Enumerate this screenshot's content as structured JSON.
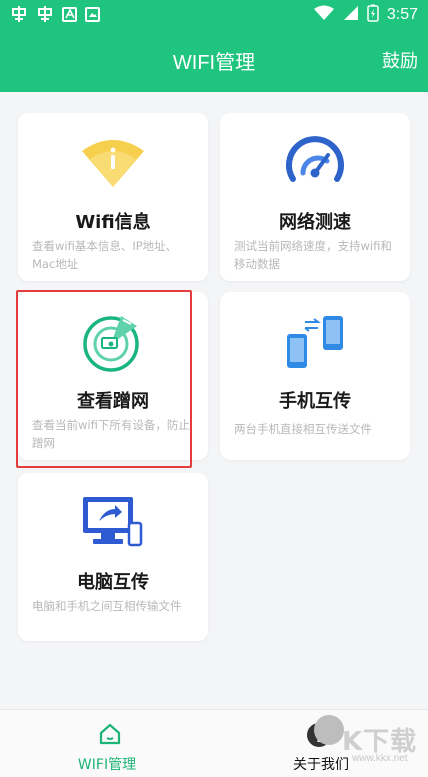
{
  "status_bar": {
    "left_icons": [
      "app-icon",
      "app-icon",
      "box-a-icon",
      "image-icon"
    ],
    "time": "3:57"
  },
  "header": {
    "title": "WIFI管理",
    "action_label": "鼓励",
    "color": "#1fc47e"
  },
  "cards": [
    {
      "id": "wifi-info",
      "title": "Wifi信息",
      "desc": "查看wifi基本信息、IP地址、Mac地址",
      "icon": "wifi-cone-icon",
      "accent": "#f6cf4c"
    },
    {
      "id": "speed-test",
      "title": "网络测速",
      "desc": "测试当前网络速度，支持wifi和移动数据",
      "icon": "speedometer-icon",
      "accent": "#2e63c9"
    },
    {
      "id": "check-leech",
      "title": "查看蹭网",
      "desc": "查看当前wifi下所有设备，防止蹭网",
      "icon": "radar-devices-icon",
      "accent": "#19b482"
    },
    {
      "id": "phone-transfer",
      "title": "手机互传",
      "desc": "两台手机直接相互传送文件",
      "icon": "phone-transfer-icon",
      "accent": "#2f8ae6"
    },
    {
      "id": "pc-transfer",
      "title": "电脑互传",
      "desc": "电脑和手机之间互相传输文件",
      "icon": "monitor-phone-icon",
      "accent": "#2f5bd2"
    }
  ],
  "highlight": {
    "target": "check-leech",
    "color": "#e43b3b"
  },
  "bottom_nav": {
    "tabs": [
      {
        "label": "WIFI管理",
        "icon": "home-icon",
        "active": true
      },
      {
        "label": "关于我们",
        "icon": "info-icon",
        "active": false
      }
    ]
  },
  "watermark": {
    "text": "K下载",
    "url": "www.kkx.net"
  }
}
